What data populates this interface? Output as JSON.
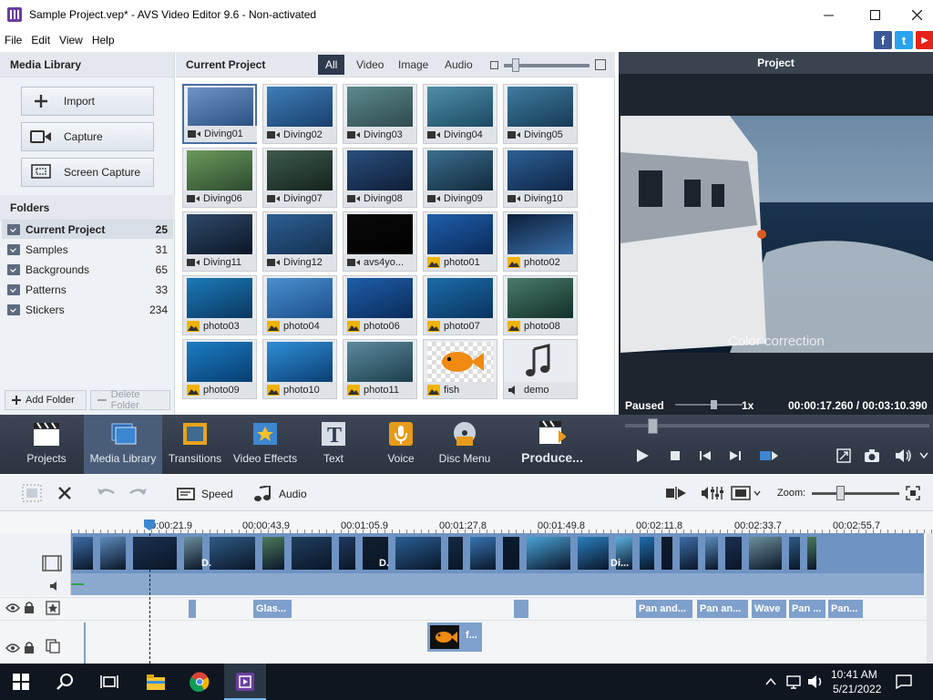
{
  "window": {
    "title": "Sample Project.vep* - AVS Video Editor 9.6 - Non-activated",
    "minimize_icon": "minimize-icon",
    "maximize_icon": "maximize-icon",
    "close_icon": "close-icon"
  },
  "menu": {
    "items": [
      "File",
      "Edit",
      "View",
      "Help"
    ]
  },
  "social": {
    "facebook": "f",
    "twitter": "t",
    "youtube": "▶"
  },
  "left": {
    "header": "Media Library",
    "import": "Import",
    "capture": "Capture",
    "screen_capture": "Screen Capture",
    "folders_header": "Folders",
    "folders": [
      {
        "name": "Current Project",
        "count": "25"
      },
      {
        "name": "Samples",
        "count": "31"
      },
      {
        "name": "Backgrounds",
        "count": "65"
      },
      {
        "name": "Patterns",
        "count": "33"
      },
      {
        "name": "Stickers",
        "count": "234"
      }
    ],
    "add_folder": "Add Folder",
    "delete_folder": "Delete Folder"
  },
  "center": {
    "header": "Current Project",
    "tabs": [
      "All",
      "Video",
      "Image",
      "Audio"
    ],
    "items": [
      {
        "name": "Diving01",
        "kind": "video"
      },
      {
        "name": "Diving02",
        "kind": "video"
      },
      {
        "name": "Diving03",
        "kind": "video"
      },
      {
        "name": "Diving04",
        "kind": "video"
      },
      {
        "name": "Diving05",
        "kind": "video"
      },
      {
        "name": "Diving06",
        "kind": "video"
      },
      {
        "name": "Diving07",
        "kind": "video"
      },
      {
        "name": "Diving08",
        "kind": "video"
      },
      {
        "name": "Diving09",
        "kind": "video"
      },
      {
        "name": "Diving10",
        "kind": "video"
      },
      {
        "name": "Diving11",
        "kind": "video"
      },
      {
        "name": "Diving12",
        "kind": "video"
      },
      {
        "name": "avs4yo...",
        "kind": "video"
      },
      {
        "name": "photo01",
        "kind": "image"
      },
      {
        "name": "photo02",
        "kind": "image"
      },
      {
        "name": "photo03",
        "kind": "image"
      },
      {
        "name": "photo04",
        "kind": "image"
      },
      {
        "name": "photo06",
        "kind": "image"
      },
      {
        "name": "photo07",
        "kind": "image"
      },
      {
        "name": "photo08",
        "kind": "image"
      },
      {
        "name": "photo09",
        "kind": "image"
      },
      {
        "name": "photo10",
        "kind": "image"
      },
      {
        "name": "photo11",
        "kind": "image"
      },
      {
        "name": "fish",
        "kind": "image"
      },
      {
        "name": "demo",
        "kind": "audio"
      }
    ]
  },
  "preview": {
    "header": "Project",
    "overlay_text": "Color correction",
    "status": "Paused",
    "speed": "1x",
    "time": "00:00:17.260 / 00:03:10.390"
  },
  "toolbar": {
    "projects": "Projects",
    "media_library": "Media Library",
    "transitions": "Transitions",
    "video_effects": "Video Effects",
    "text": "Text",
    "voice": "Voice",
    "disc_menu": "Disc Menu",
    "produce": "Produce..."
  },
  "timeline": {
    "speed": "Speed",
    "audio": "Audio",
    "zoom": "Zoom:",
    "ruler": [
      "00:00:21.9",
      "00:00:43.9",
      "00:01:05.9",
      "00:01:27.8",
      "00:01:49.8",
      "00:02:11.8",
      "00:02:33.7",
      "00:02:55.7"
    ],
    "clip_labels": [
      "D.",
      "D.",
      "Di..."
    ],
    "effects": [
      "Glas...",
      "Pan and...",
      "Pan an...",
      "Wave",
      "Pan ...",
      "Pan..."
    ],
    "overlay_clip": "f..."
  },
  "taskbar": {
    "time": "10:41 AM",
    "date": "5/21/2022"
  }
}
